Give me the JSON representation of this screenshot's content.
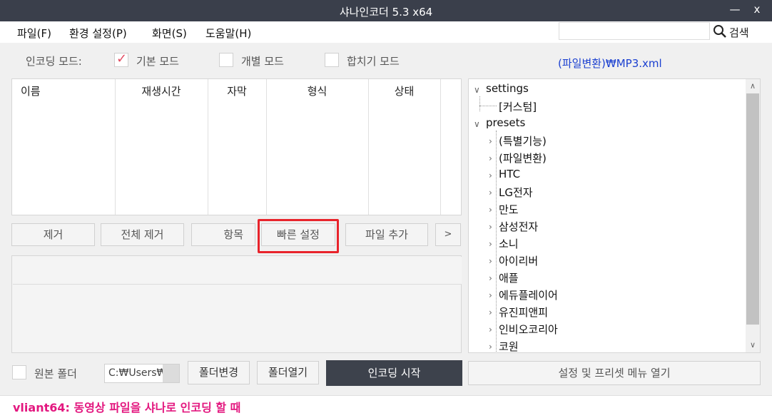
{
  "window": {
    "title": "샤나인코더  5.3  x64",
    "minimize_glyph": "—",
    "close_glyph": "x"
  },
  "menu": {
    "items": [
      "파일(F)",
      "환경 설정(P)",
      "화면(S)",
      "도움말(H)"
    ],
    "search_value": "",
    "search_label": "검색",
    "search_icon": "magnifier-icon"
  },
  "mode": {
    "label": "인코딩 모드:",
    "options": [
      {
        "label": "기본 모드",
        "checked": true
      },
      {
        "label": "개별 모드",
        "checked": false
      },
      {
        "label": "합치기 모드",
        "checked": false
      }
    ],
    "check_glyph": "✓",
    "check_color": "#e24c62"
  },
  "preset_path": "(파일변환)₩MP3.xml",
  "file_list": {
    "columns": [
      "이름",
      "재생시간",
      "자막",
      "형식",
      "상태"
    ]
  },
  "action_buttons": [
    "제거",
    "전체 제거",
    "항목",
    "빠른 설정",
    "파일 추가",
    ">"
  ],
  "tree": {
    "nodes": [
      {
        "label": "settings",
        "expanded": true,
        "children": [
          "[커스텀]"
        ]
      },
      {
        "label": "presets",
        "expanded": true,
        "children": [
          "(특별기능)",
          "(파일변환)",
          "HTC",
          "LG전자",
          "만도",
          "삼성전자",
          "소니",
          "아이리버",
          "애플",
          "에듀플레이어",
          "유진피앤피",
          "인비오코리아",
          "코원"
        ]
      }
    ]
  },
  "bottom": {
    "source_folder_label": "원본 폴더",
    "source_folder_checked": false,
    "folder_path": "C:₩Users₩",
    "change_folder": "폴더변경",
    "open_folder": "폴더열기",
    "start_encoding": "인코딩 시작",
    "open_preset_menu": "설정 및 프리셋 메뉴 열기"
  },
  "status": {
    "text": "vliant64: 동영상 파일을 샤나로 인코딩 할 때",
    "color": "#e3177f"
  },
  "highlight": {
    "target": "빠른 설정",
    "color": "#e8232b"
  }
}
